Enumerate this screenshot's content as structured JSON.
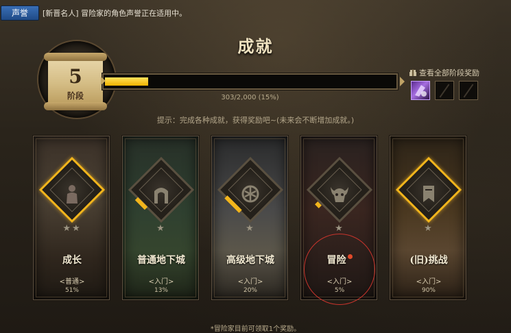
{
  "topbar": {
    "fame_button": "声誉",
    "fame_text": "[新晋名人] 冒险家的角色声誉正在适用中。"
  },
  "title": "成就",
  "stage": {
    "number": "5",
    "label": "阶段"
  },
  "progress": {
    "text": "303/2,000 (15%)",
    "fraction": 0.15
  },
  "rewards": {
    "link_label": "查看全部阶段奖励",
    "slots": [
      "filled",
      "empty",
      "empty"
    ]
  },
  "hint": "提示：完成各种成就，获得奖励吧~(未来会不断增加成就。)",
  "cards": [
    {
      "name": "成长",
      "tier": "<普通>",
      "percent": "51%",
      "stars": "★★",
      "alert": false,
      "icon": "person-icon"
    },
    {
      "name": "普通地下城",
      "tier": "<入门>",
      "percent": "13%",
      "stars": "★",
      "alert": false,
      "icon": "gate-icon"
    },
    {
      "name": "高级地下城",
      "tier": "<入门>",
      "percent": "20%",
      "stars": "★",
      "alert": false,
      "icon": "rune-icon"
    },
    {
      "name": "冒险",
      "tier": "<入门>",
      "percent": "5%",
      "stars": "★",
      "alert": true,
      "icon": "demon-icon"
    },
    {
      "name": "(旧)挑战",
      "tier": "<入门>",
      "percent": "90%",
      "stars": "★",
      "alert": false,
      "icon": "banner-icon"
    }
  ],
  "footer": "*冒险家目前可领取1个奖励。",
  "colors": {
    "accent_gold": "#f2b51c",
    "button_blue": "#2b5ea0",
    "alert_red": "#e24a2a"
  }
}
